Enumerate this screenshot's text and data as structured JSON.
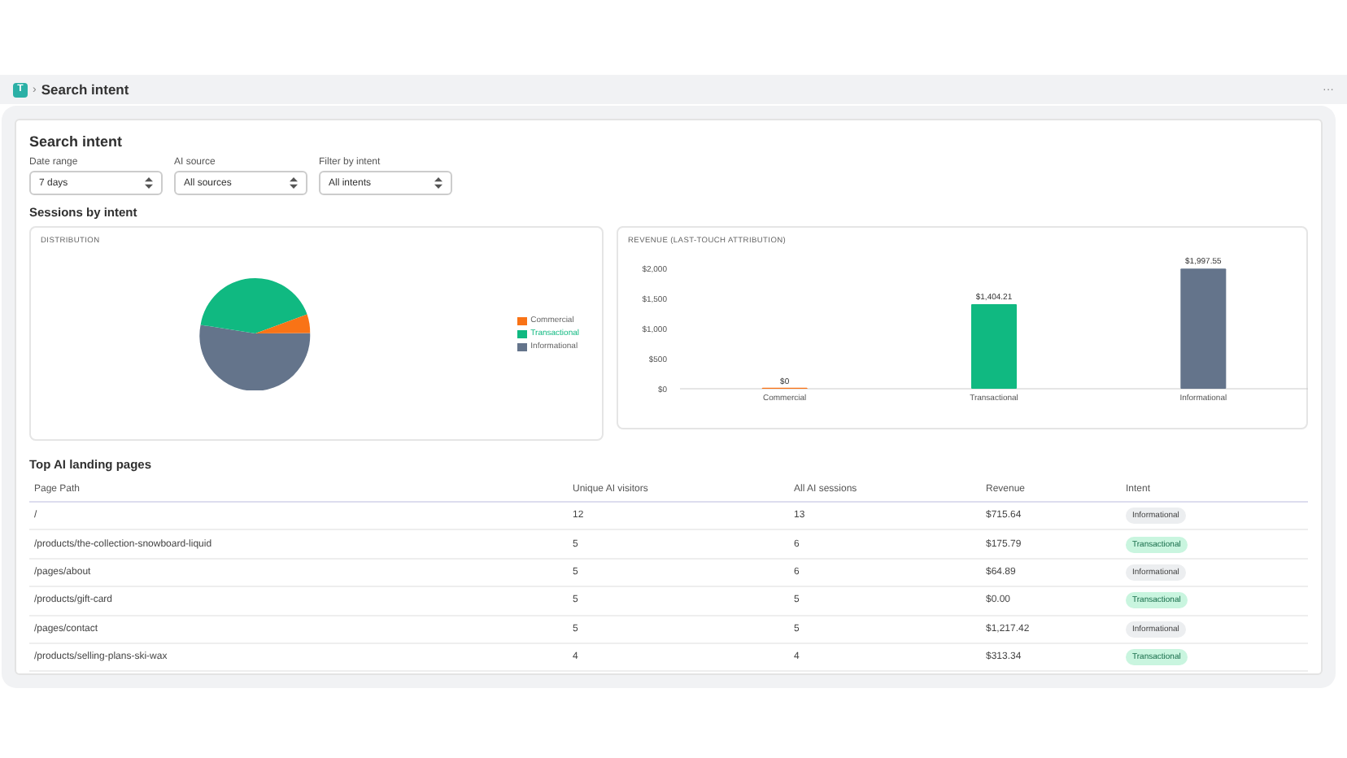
{
  "breadcrumb": {
    "app_initial": "T",
    "separator": "›",
    "title": "Search intent"
  },
  "menu_dots": "···",
  "page": {
    "title": "Search intent"
  },
  "filters": [
    {
      "label": "Date range",
      "value": "7 days"
    },
    {
      "label": "AI source",
      "value": "All sources"
    },
    {
      "label": "Filter by intent",
      "value": "All intents"
    }
  ],
  "sessions": {
    "title": "Sessions by intent",
    "distribution": {
      "title": "DISTRIBUTION",
      "legend": [
        {
          "label": "Commercial",
          "color": "#f97316",
          "selected": false
        },
        {
          "label": "Transactional",
          "color": "#10b981",
          "selected": true
        },
        {
          "label": "Informational",
          "color": "#64748b",
          "selected": false
        }
      ]
    },
    "revenue": {
      "title": "REVENUE (LAST-TOUCH ATTRIBUTION)",
      "chart_data": {
        "type": "bar",
        "categories": [
          "Commercial",
          "Transactional",
          "Informational"
        ],
        "series": [
          {
            "color": "#f97316",
            "values": [
              0,
              null,
              null
            ]
          },
          {
            "color": "#10b981",
            "values": [
              null,
              1404.21,
              null
            ]
          },
          {
            "color": "#64748b",
            "values": [
              null,
              null,
              1997.55
            ]
          }
        ],
        "stacked": true,
        "ylim": [
          0,
          2000
        ],
        "yticks": [
          {
            "value": 0,
            "label": "$0"
          },
          {
            "value": 500,
            "label": "$500"
          },
          {
            "value": 1000,
            "label": "$1,000"
          },
          {
            "value": 1500,
            "label": "$1,500"
          },
          {
            "value": 2000,
            "label": "$2,000"
          }
        ],
        "value_labels": [
          "$0",
          "$1,404.21",
          "$1,997.55"
        ]
      }
    }
  },
  "landing": {
    "title": "Top AI landing pages",
    "columns": [
      "Page Path",
      "Unique AI visitors",
      "All AI sessions",
      "Revenue",
      "Intent"
    ],
    "rows": [
      {
        "path": "/",
        "visitors": "12",
        "sessions": "13",
        "revenue": "$715.64",
        "intent": "Informational",
        "kind": "informational"
      },
      {
        "path": "/products/the-collection-snowboard-liquid",
        "visitors": "5",
        "sessions": "6",
        "revenue": "$175.79",
        "intent": "Transactional",
        "kind": "transactional"
      },
      {
        "path": "/pages/about",
        "visitors": "5",
        "sessions": "6",
        "revenue": "$64.89",
        "intent": "Informational",
        "kind": "informational"
      },
      {
        "path": "/products/gift-card",
        "visitors": "5",
        "sessions": "5",
        "revenue": "$0.00",
        "intent": "Transactional",
        "kind": "transactional"
      },
      {
        "path": "/pages/contact",
        "visitors": "5",
        "sessions": "5",
        "revenue": "$1,217.42",
        "intent": "Informational",
        "kind": "informational"
      },
      {
        "path": "/products/selling-plans-ski-wax",
        "visitors": "4",
        "sessions": "4",
        "revenue": "$313.34",
        "intent": "Transactional",
        "kind": "transactional"
      }
    ]
  }
}
